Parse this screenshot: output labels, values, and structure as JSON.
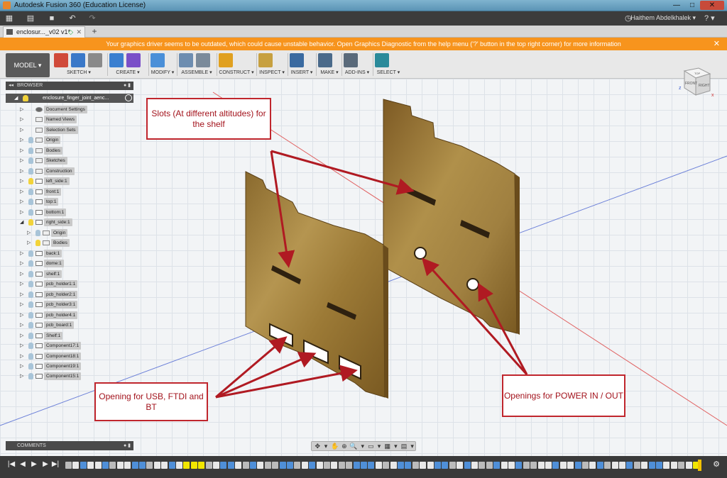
{
  "window": {
    "title": "Autodesk Fusion 360 (Education License)",
    "minimize": "—",
    "maximize": "□",
    "close": "✕"
  },
  "quick_access": {
    "grid_icon": "▦",
    "file_icon": "▤",
    "save_icon": "■",
    "undo_icon": "↶",
    "redo_icon": "↷",
    "user": "Haithem Abdelkhalek ▾",
    "help": "? ▾",
    "clock_icon": "◷"
  },
  "tabs": {
    "doc_name": "enclosur..._v02 v1*",
    "status_icon": "◇",
    "close_icon": "✕",
    "new_tab": "+"
  },
  "warning": {
    "text": "Your graphics driver seems to be outdated, which could cause unstable behavior. Open Graphics Diagnostic from the help menu ('?' button in the top right corner) for more information",
    "close_icon": "✕"
  },
  "ribbon": {
    "workspace": "MODEL ▾",
    "groups": [
      {
        "label": "SKETCH ▾",
        "icons": [
          "sketch-icon",
          "line-icon",
          "rectangle-icon"
        ],
        "colors": [
          "#d04a3a",
          "#3a78c8",
          "#8a8a8a"
        ]
      },
      {
        "label": "CREATE ▾",
        "icons": [
          "extrude-icon",
          "sphere-icon"
        ],
        "colors": [
          "#3a7fd0",
          "#7a4fc8"
        ]
      },
      {
        "label": "MODIFY ▾",
        "icons": [
          "pressPull-icon"
        ],
        "colors": [
          "#4a8fd8"
        ]
      },
      {
        "label": "ASSEMBLE ▾",
        "icons": [
          "component-icon",
          "joint-icon"
        ],
        "colors": [
          "#6d8db0",
          "#7a8a9a"
        ]
      },
      {
        "label": "CONSTRUCT ▾",
        "icons": [
          "plane-icon"
        ],
        "colors": [
          "#e0a020"
        ]
      },
      {
        "label": "INSPECT ▾",
        "icons": [
          "measure-icon"
        ],
        "colors": [
          "#c7a040"
        ]
      },
      {
        "label": "INSERT ▾",
        "icons": [
          "image-icon"
        ],
        "colors": [
          "#3a6aa0"
        ]
      },
      {
        "label": "MAKE ▾",
        "icons": [
          "print-icon"
        ],
        "colors": [
          "#4a6a8a"
        ]
      },
      {
        "label": "ADD-INS ▾",
        "icons": [
          "addins-icon"
        ],
        "colors": [
          "#5a6a7a"
        ]
      },
      {
        "label": "SELECT ▾",
        "icons": [
          "select-icon"
        ],
        "colors": [
          "#2a8a9a"
        ]
      }
    ]
  },
  "browser": {
    "title": "BROWSER",
    "collapse_icon": "◂◂",
    "header_buttons": "● ▮",
    "root": "enclosure_finger_joint_aenc...",
    "tree": [
      {
        "label": "Document Settings",
        "level": 0,
        "kind": "gear",
        "bulb": false,
        "tri": "▷"
      },
      {
        "label": "Named Views",
        "level": 0,
        "kind": "folder",
        "bulb": false,
        "tri": "▷"
      },
      {
        "label": "Selection Sets",
        "level": 0,
        "kind": "folder",
        "bulb": false,
        "tri": "▷"
      },
      {
        "label": "Origin",
        "level": 0,
        "kind": "folder",
        "bulb": "off",
        "tri": "▷"
      },
      {
        "label": "Bodies",
        "level": 0,
        "kind": "folder",
        "bulb": "off",
        "tri": "▷"
      },
      {
        "label": "Sketches",
        "level": 0,
        "kind": "folder",
        "bulb": "off",
        "tri": "▷"
      },
      {
        "label": "Construction",
        "level": 0,
        "kind": "folder",
        "bulb": "off",
        "tri": "▷"
      },
      {
        "label": "left_side:1",
        "level": 0,
        "kind": "comp",
        "bulb": "on",
        "tri": "▷"
      },
      {
        "label": "front:1",
        "level": 0,
        "kind": "comp",
        "bulb": "off",
        "tri": "▷"
      },
      {
        "label": "top:1",
        "level": 0,
        "kind": "comp",
        "bulb": "off",
        "tri": "▷"
      },
      {
        "label": "bottom:1",
        "level": 0,
        "kind": "comp",
        "bulb": "off",
        "tri": "▷"
      },
      {
        "label": "right_side:1",
        "level": 0,
        "kind": "comp",
        "bulb": "on",
        "tri": "◢"
      },
      {
        "label": "Origin",
        "level": 1,
        "kind": "folder",
        "bulb": "off",
        "tri": "▷"
      },
      {
        "label": "Bodies",
        "level": 1,
        "kind": "folder",
        "bulb": "on",
        "tri": "▷"
      },
      {
        "label": "back:1",
        "level": 0,
        "kind": "comp",
        "bulb": "off",
        "tri": "▷"
      },
      {
        "label": "dome:1",
        "level": 0,
        "kind": "comp",
        "bulb": "off",
        "tri": "▷"
      },
      {
        "label": "shelf:1",
        "level": 0,
        "kind": "comp",
        "bulb": "off",
        "tri": "▷"
      },
      {
        "label": "pcb_holder1:1",
        "level": 0,
        "kind": "comp",
        "bulb": "off",
        "tri": "▷"
      },
      {
        "label": "pcb_holder2:1",
        "level": 0,
        "kind": "comp",
        "bulb": "off",
        "tri": "▷"
      },
      {
        "label": "pcb_holder3:1",
        "level": 0,
        "kind": "comp",
        "bulb": "off",
        "tri": "▷"
      },
      {
        "label": "pcb_holder4:1",
        "level": 0,
        "kind": "comp",
        "bulb": "off",
        "tri": "▷"
      },
      {
        "label": "pcb_board:1",
        "level": 0,
        "kind": "comp",
        "bulb": "off",
        "tri": "▷"
      },
      {
        "label": "Shelf:1",
        "level": 0,
        "kind": "comp",
        "bulb": "off",
        "tri": "▷"
      },
      {
        "label": "Component17:1",
        "level": 0,
        "kind": "comp",
        "bulb": "off",
        "tri": "▷"
      },
      {
        "label": "Component18:1",
        "level": 0,
        "kind": "comp",
        "bulb": "off",
        "tri": "▷"
      },
      {
        "label": "Component19:1",
        "level": 0,
        "kind": "comp",
        "bulb": "off",
        "tri": "▷"
      },
      {
        "label": "Component15:1",
        "level": 0,
        "kind": "comp",
        "bulb": "off",
        "tri": "▷"
      }
    ]
  },
  "comments": {
    "title": "COMMENTS",
    "header_buttons": "● ▮"
  },
  "navbar": {
    "buttons": [
      "✥",
      "▾",
      "✋",
      "⊕",
      "🔍",
      "▾",
      "▭",
      "▾",
      "▦",
      "▾",
      "▤",
      "▾"
    ]
  },
  "viewcube": {
    "front": "FRONT",
    "right": "RIGHT",
    "top": "TOP",
    "axis_x": "x",
    "axis_z": "z"
  },
  "annotations": {
    "slots": "Slots (At different altitudes) for the shelf",
    "usb": "Opening for USB, FTDI and BT",
    "power": "Openings for POWER IN / OUT"
  },
  "timeline": {
    "first_icon": "|◀",
    "prev_icon": "◀",
    "play_icon": "▶",
    "next_icon": "▶",
    "last_icon": "▶|",
    "settings_icon": "⚙",
    "feature_colors": {
      "sketch": "#e8e8e8",
      "body": "#4f8fd8",
      "move": "#bbbbbb",
      "highlight": "#f2e600"
    },
    "features": [
      "move",
      "sketch",
      "body",
      "sketch",
      "sketch",
      "body",
      "move",
      "sketch",
      "sketch",
      "body",
      "body",
      "move",
      "sketch",
      "sketch",
      "body",
      "sketch",
      "highlight",
      "highlight",
      "highlight",
      "move",
      "sketch",
      "body",
      "body",
      "sketch",
      "move",
      "body",
      "sketch",
      "move",
      "move",
      "body",
      "body",
      "move",
      "sketch",
      "body",
      "sketch",
      "move",
      "sketch",
      "move",
      "move",
      "body",
      "body",
      "body",
      "sketch",
      "move",
      "sketch",
      "body",
      "body",
      "move",
      "sketch",
      "sketch",
      "body",
      "body",
      "move",
      "sketch",
      "body",
      "sketch",
      "move",
      "move",
      "body",
      "sketch",
      "sketch",
      "body",
      "move",
      "move",
      "sketch",
      "sketch",
      "body",
      "sketch",
      "sketch",
      "body",
      "move",
      "sketch",
      "body",
      "move",
      "sketch",
      "sketch",
      "body",
      "move",
      "sketch",
      "body",
      "body",
      "sketch",
      "sketch",
      "move",
      "sketch",
      "highlight"
    ]
  }
}
